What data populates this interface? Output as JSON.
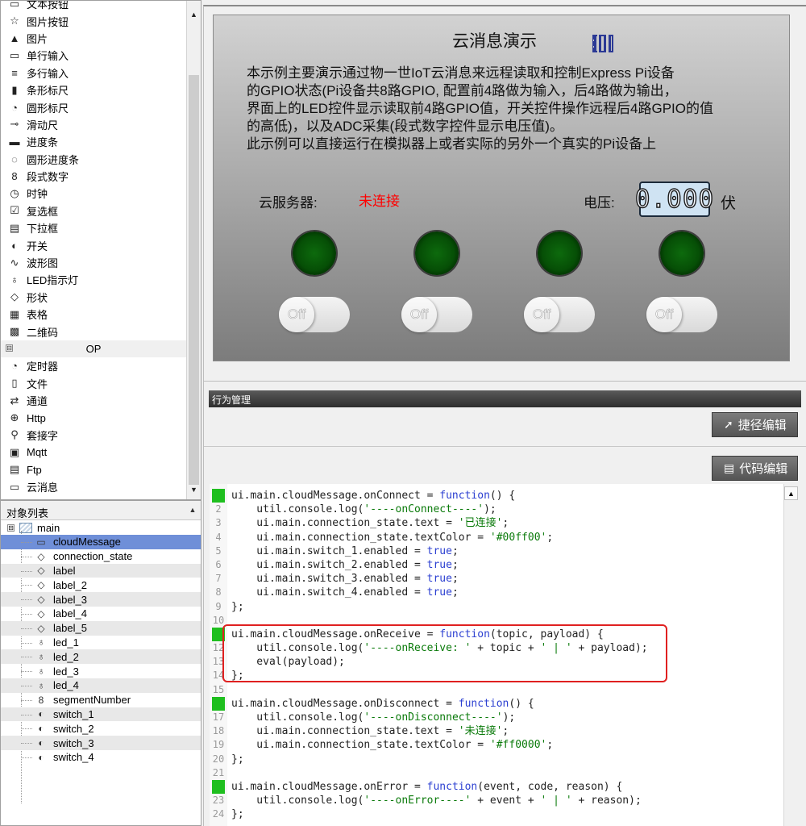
{
  "palette": {
    "items": [
      {
        "label": "文本按钮",
        "icon": "text-button-icon",
        "glyph": "▭"
      },
      {
        "label": "图片按钮",
        "icon": "star-image-button-icon",
        "glyph": "☆"
      },
      {
        "label": "图片",
        "icon": "picture-icon",
        "glyph": "▲"
      },
      {
        "label": "单行输入",
        "icon": "single-line-input-icon",
        "glyph": "▭"
      },
      {
        "label": "多行输入",
        "icon": "multi-line-input-icon",
        "glyph": "≡"
      },
      {
        "label": "条形标尺",
        "icon": "bar-ruler-icon",
        "glyph": "▮"
      },
      {
        "label": "圆形标尺",
        "icon": "gauge-icon",
        "glyph": "◔"
      },
      {
        "label": "滑动尺",
        "icon": "slider-icon",
        "glyph": "⊸"
      },
      {
        "label": "进度条",
        "icon": "progress-bar-icon",
        "glyph": "▬"
      },
      {
        "label": "圆形进度条",
        "icon": "circle-progress-icon",
        "glyph": "◌"
      },
      {
        "label": "段式数字",
        "icon": "segment-digit-icon",
        "glyph": "8"
      },
      {
        "label": "时钟",
        "icon": "clock-icon",
        "glyph": "◷"
      },
      {
        "label": "复选框",
        "icon": "checkbox-icon",
        "glyph": "☑"
      },
      {
        "label": "下拉框",
        "icon": "dropdown-icon",
        "glyph": "▤"
      },
      {
        "label": "开关",
        "icon": "toggle-icon",
        "glyph": "◐"
      },
      {
        "label": "波形图",
        "icon": "waveform-icon",
        "glyph": "∿"
      },
      {
        "label": "LED指示灯",
        "icon": "led-bulb-icon",
        "glyph": "♁"
      },
      {
        "label": "形状",
        "icon": "shapes-icon",
        "glyph": "◇"
      },
      {
        "label": "表格",
        "icon": "table-icon",
        "glyph": "▦"
      },
      {
        "label": "二维码",
        "icon": "qrcode-icon",
        "glyph": "▩"
      }
    ],
    "group_label": "OP",
    "group_collapse": "⊟",
    "op_items": [
      {
        "label": "定时器",
        "icon": "timer-icon",
        "glyph": "◔"
      },
      {
        "label": "文件",
        "icon": "file-icon",
        "glyph": "▯"
      },
      {
        "label": "通道",
        "icon": "channel-icon",
        "glyph": "⇄"
      },
      {
        "label": "Http",
        "icon": "globe-icon",
        "glyph": "⊕"
      },
      {
        "label": "套接字",
        "icon": "socket-icon",
        "glyph": "⚲"
      },
      {
        "label": "Mqtt",
        "icon": "mqtt-icon",
        "glyph": "▣"
      },
      {
        "label": "Ftp",
        "icon": "ftp-icon",
        "glyph": "▤"
      },
      {
        "label": "云消息",
        "icon": "cloud-message-icon",
        "glyph": "▭"
      }
    ]
  },
  "objlist": {
    "title": "对象列表",
    "root": "main",
    "root_collapse": "⊟",
    "items": [
      {
        "label": "cloudMessage",
        "icon": "cloud-message-icon",
        "glyph": "▭"
      },
      {
        "label": "connection_state",
        "icon": "label-icon",
        "glyph": "◇"
      },
      {
        "label": "label",
        "icon": "label-icon",
        "glyph": "◇"
      },
      {
        "label": "label_2",
        "icon": "label-icon",
        "glyph": "◇"
      },
      {
        "label": "label_3",
        "icon": "label-icon",
        "glyph": "◇"
      },
      {
        "label": "label_4",
        "icon": "label-icon",
        "glyph": "◇"
      },
      {
        "label": "label_5",
        "icon": "label-icon",
        "glyph": "◇"
      },
      {
        "label": "led_1",
        "icon": "led-bulb-icon",
        "glyph": "♁"
      },
      {
        "label": "led_2",
        "icon": "led-bulb-icon",
        "glyph": "♁"
      },
      {
        "label": "led_3",
        "icon": "led-bulb-icon",
        "glyph": "♁"
      },
      {
        "label": "led_4",
        "icon": "led-bulb-icon",
        "glyph": "♁"
      },
      {
        "label": "segmentNumber",
        "icon": "segment-digit-icon",
        "glyph": "8"
      },
      {
        "label": "switch_1",
        "icon": "toggle-icon",
        "glyph": "◐"
      },
      {
        "label": "switch_2",
        "icon": "toggle-icon",
        "glyph": "◐"
      },
      {
        "label": "switch_3",
        "icon": "toggle-icon",
        "glyph": "◐"
      },
      {
        "label": "switch_4",
        "icon": "toggle-icon",
        "glyph": "◐"
      }
    ],
    "selected_index": 0
  },
  "preview": {
    "title": "云消息演示",
    "description": "本示例主要演示通过物一世IoT云消息来远程读取和控制Express Pi设备\n的GPIO状态(Pi设备共8路GPIO, 配置前4路做为输入，后4路做为输出，\n界面上的LED控件显示读取前4路GPIO值，开关控件操作远程后4路GPIO的值\n的高低)，以及ADC采集(段式数字控件显示电压值)。\n此示例可以直接运行在模拟器上或者实际的另外一个真实的Pi设备上",
    "server_label": "云服务器:",
    "server_status": "未连接",
    "server_status_color": "#ff0000",
    "voltage_label": "电压:",
    "voltage_value": "0.000",
    "voltage_unit": "伏",
    "switch_text": "Off",
    "led_color": "#0a5e0a"
  },
  "behavior": {
    "title": "行为管理",
    "shortcut_edit": "捷径编辑",
    "code_edit": "代码编辑"
  },
  "editor": {
    "lines": [
      {
        "n": "1",
        "bp": true,
        "code": "ui.main.cloudMessage.onConnect = function() {"
      },
      {
        "n": "2",
        "bp": false,
        "code": "    util.console.log('----onConnect----');"
      },
      {
        "n": "3",
        "bp": false,
        "code": "    ui.main.connection_state.text = '已连接';"
      },
      {
        "n": "4",
        "bp": false,
        "code": "    ui.main.connection_state.textColor = '#00ff00';"
      },
      {
        "n": "5",
        "bp": false,
        "code": "    ui.main.switch_1.enabled = true;"
      },
      {
        "n": "6",
        "bp": false,
        "code": "    ui.main.switch_2.enabled = true;"
      },
      {
        "n": "7",
        "bp": false,
        "code": "    ui.main.switch_3.enabled = true;"
      },
      {
        "n": "8",
        "bp": false,
        "code": "    ui.main.switch_4.enabled = true;"
      },
      {
        "n": "9",
        "bp": false,
        "code": "};"
      },
      {
        "n": "10",
        "bp": false,
        "code": ""
      },
      {
        "n": "11",
        "bp": true,
        "code": "ui.main.cloudMessage.onReceive = function(topic, payload) {"
      },
      {
        "n": "12",
        "bp": false,
        "code": "    util.console.log('----onReceive: ' + topic + ' | ' + payload);"
      },
      {
        "n": "13",
        "bp": false,
        "code": "    eval(payload);"
      },
      {
        "n": "14",
        "bp": false,
        "code": "};"
      },
      {
        "n": "15",
        "bp": false,
        "code": ""
      },
      {
        "n": "16",
        "bp": true,
        "code": "ui.main.cloudMessage.onDisconnect = function() {"
      },
      {
        "n": "17",
        "bp": false,
        "code": "    util.console.log('----onDisconnect----');"
      },
      {
        "n": "18",
        "bp": false,
        "code": "    ui.main.connection_state.text = '未连接';"
      },
      {
        "n": "19",
        "bp": false,
        "code": "    ui.main.connection_state.textColor = '#ff0000';"
      },
      {
        "n": "20",
        "bp": false,
        "code": "};"
      },
      {
        "n": "21",
        "bp": false,
        "code": ""
      },
      {
        "n": "22",
        "bp": true,
        "code": "ui.main.cloudMessage.onError = function(event, code, reason) {"
      },
      {
        "n": "23",
        "bp": false,
        "code": "    util.console.log('----onError----' + event + ' | ' + reason);"
      },
      {
        "n": "24",
        "bp": false,
        "code": "};"
      }
    ],
    "highlight_color": "#e02020"
  }
}
